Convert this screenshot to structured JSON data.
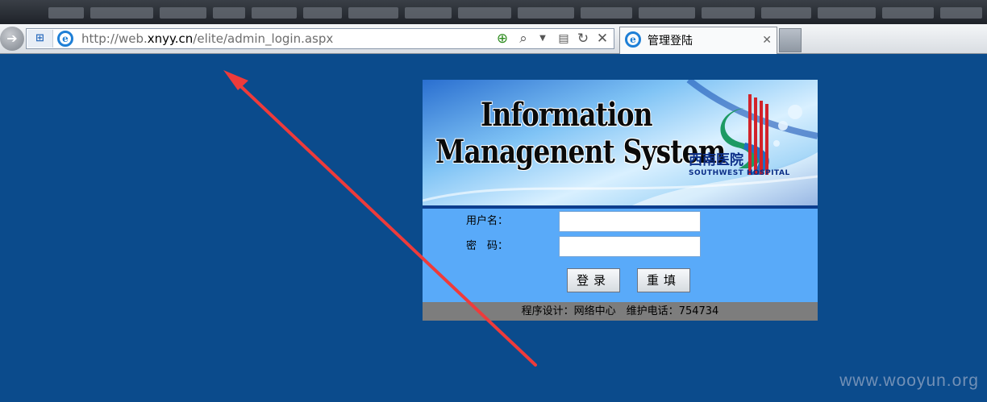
{
  "browser": {
    "url_prefix": "http://web.",
    "url_host": "xnyy.cn",
    "url_path": "/elite/admin_login.aspx",
    "tab_title": "管理登陆",
    "back_icon": "back-arrow-icon",
    "tab_close": "✕"
  },
  "login": {
    "banner_title_line1": "Information",
    "banner_title_line2": "Managenent System",
    "hospital_cn": "西南医院",
    "hospital_en": "SOUTHWEST HOSPITAL",
    "username_label": "用户名：",
    "password_label": "密　码：",
    "login_button": "登录",
    "reset_button": "重填",
    "footer": "程序设计：网络中心　维护电话：754734"
  },
  "watermark": "www.wooyun.org",
  "colors": {
    "page_bg": "#0b4b8c",
    "form_bg": "#59aaf9",
    "footer_bg": "#7d7d7d",
    "arrow": "#ee3b3b"
  }
}
